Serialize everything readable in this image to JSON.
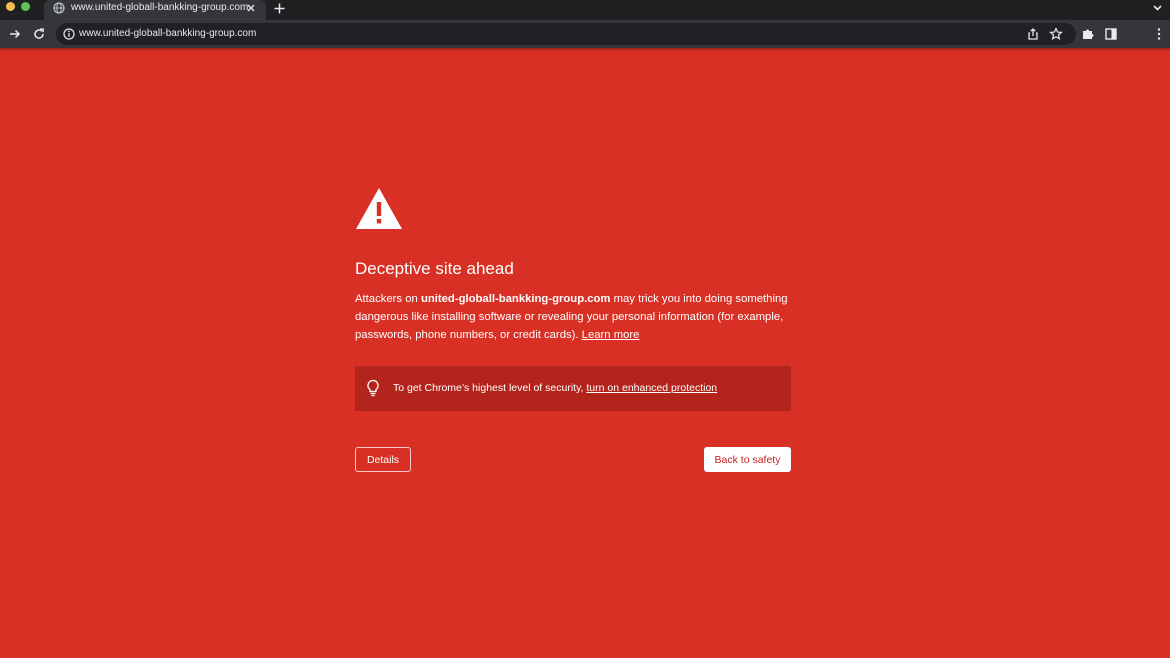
{
  "browser": {
    "tab_title": "www.united-globall-bankking-group.com",
    "url": "www.united-globall-bankking-group.com"
  },
  "icons": {
    "favicon": "globe-icon",
    "tab_close": "close-icon",
    "new_tab": "plus-icon",
    "tab_search": "chevron-down-icon",
    "forward": "forward-arrow-icon",
    "reload": "reload-icon",
    "site_info": "info-icon",
    "share": "share-icon",
    "bookmark": "star-icon",
    "extensions": "puzzle-icon",
    "side_panel": "side-panel-icon",
    "menu": "kebab-menu-icon",
    "warning": "warning-triangle-icon",
    "tip": "lightbulb-icon"
  },
  "interstitial": {
    "heading": "Deceptive site ahead",
    "body_prefix": "Attackers on ",
    "body_domain": "united-globall-bankking-group.com",
    "body_suffix": " may trick you into doing something dangerous like installing software or revealing your personal information (for example, passwords, phone numbers, or credit cards). ",
    "learn_more": "Learn more",
    "promo_text": "To get Chrome’s highest level of security, ",
    "promo_link": "turn on enhanced protection",
    "details_button": "Details",
    "back_button": "Back to safety"
  },
  "colors": {
    "page_background": "#d93025",
    "promo_background": "#b3251c",
    "back_button_text": "#c5221f",
    "chrome_dark": "#35363a"
  }
}
